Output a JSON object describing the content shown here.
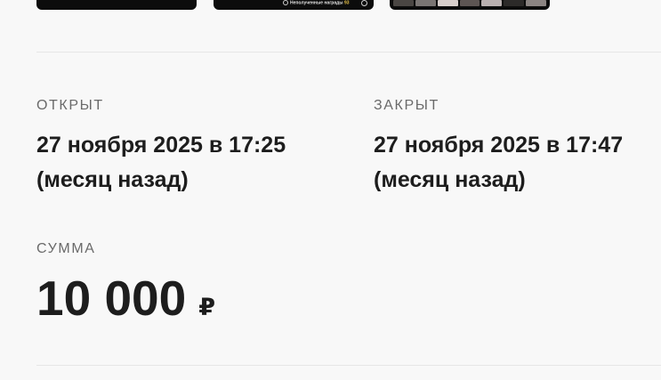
{
  "thumbnails": [
    {
      "caption": "",
      "count": ""
    },
    {
      "caption": "Неполученные награды",
      "count": "93"
    },
    {
      "caption": "",
      "count": ""
    }
  ],
  "details": {
    "opened_label": "ОТКРЫТ",
    "opened_date": "27 ноября 2025 в 17:25",
    "opened_relative": "(месяц назад)",
    "closed_label": "ЗАКРЫТ",
    "closed_date": "27 ноября 2025 в 17:47",
    "closed_relative": "(месяц назад)",
    "sum_label": "СУММА",
    "sum_value": "10 000",
    "sum_currency": "₽"
  }
}
